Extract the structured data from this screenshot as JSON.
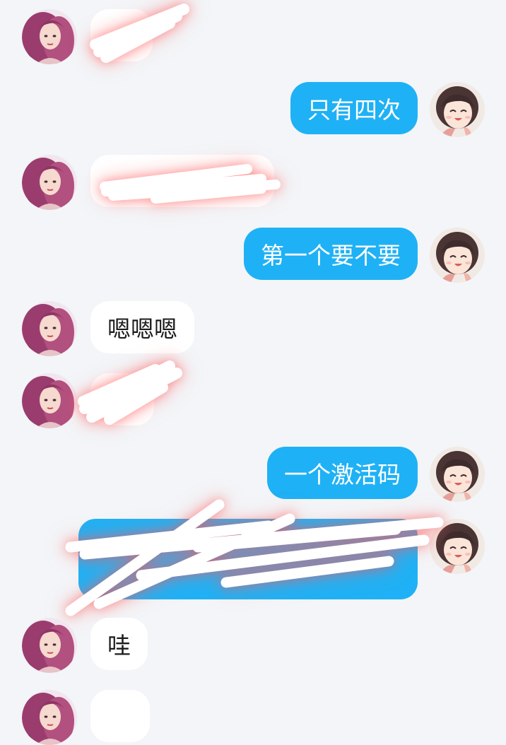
{
  "colors": {
    "background": "#f3f5f8",
    "outgoing_bubble": "#1fb1f5",
    "incoming_bubble": "#ffffff",
    "outgoing_text": "#ffffff",
    "incoming_text": "#1b1b1b"
  },
  "messages": [
    {
      "side": "left",
      "sender": "contact",
      "text": "",
      "redacted": true
    },
    {
      "side": "right",
      "sender": "me",
      "text": "只有四次"
    },
    {
      "side": "left",
      "sender": "contact",
      "text": "",
      "redacted": true
    },
    {
      "side": "right",
      "sender": "me",
      "text": "第一个要不要"
    },
    {
      "side": "left",
      "sender": "contact",
      "text": "嗯嗯嗯"
    },
    {
      "side": "left",
      "sender": "contact",
      "text": "",
      "redacted": true
    },
    {
      "side": "right",
      "sender": "me",
      "text": "一个激活码"
    },
    {
      "side": "right",
      "sender": "me",
      "text": "",
      "redacted": true
    },
    {
      "side": "left",
      "sender": "contact",
      "text": "哇"
    },
    {
      "side": "left",
      "sender": "contact",
      "text": "",
      "partially_visible": true
    }
  ]
}
